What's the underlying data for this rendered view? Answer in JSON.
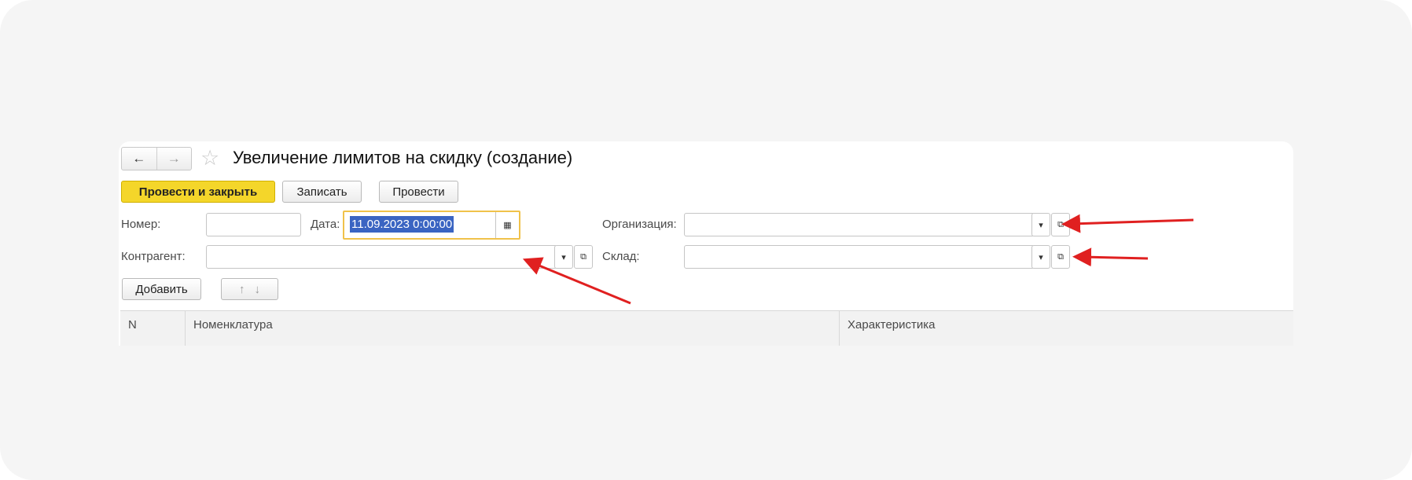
{
  "window": {
    "title": "Увеличение лимитов на скидку (создание)",
    "nav_back": "←",
    "nav_forward": "→",
    "favorite_icon": "☆"
  },
  "toolbar": {
    "post_and_close": "Провести и закрыть",
    "save": "Записать",
    "post": "Провести",
    "accent_color": "#f4d62a"
  },
  "form": {
    "number_label": "Номер:",
    "number_value": "",
    "date_label": "Дата:",
    "date_value": "11.09.2023  0:00:00",
    "organization_label": "Организация:",
    "organization_value": "",
    "counterparty_label": "Контрагент:",
    "counterparty_value": "",
    "warehouse_label": "Склад:",
    "warehouse_value": ""
  },
  "table_toolbar": {
    "add": "Добавить",
    "move_up_icon": "↑",
    "move_down_icon": "↓"
  },
  "table": {
    "columns": [
      "N",
      "Номенклатура",
      "Характеристика"
    ]
  },
  "annotations": {
    "arrow_color": "#e02020"
  }
}
